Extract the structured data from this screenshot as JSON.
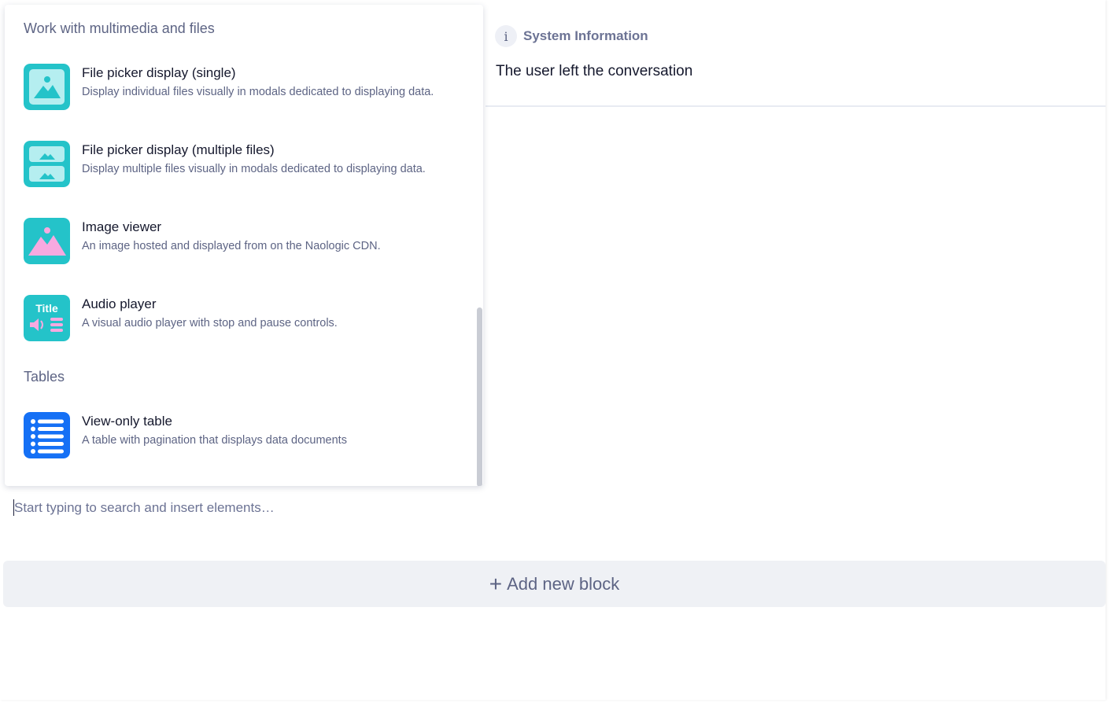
{
  "system_info": {
    "title": "System Information",
    "icon_glyph": "i",
    "message": "The user left the conversation"
  },
  "picker": {
    "sections": [
      {
        "title": "Work with multimedia and files",
        "items": [
          {
            "icon": "file-picker-single-icon",
            "name": "File picker display (single)",
            "description": "Display individual files visually in modals dedicated to displaying data."
          },
          {
            "icon": "file-picker-multiple-icon",
            "name": "File picker display (multiple files)",
            "description": "Display multiple files visually in modals dedicated to displaying data."
          },
          {
            "icon": "image-viewer-icon",
            "name": "Image viewer",
            "description": "An image hosted and displayed from on the Naologic CDN."
          },
          {
            "icon": "audio-player-icon",
            "name": "Audio player",
            "description": "A visual audio player with stop and pause controls.",
            "icon_text": "Title"
          }
        ]
      },
      {
        "title": "Tables",
        "items": [
          {
            "icon": "table-icon",
            "name": "View-only table",
            "description": "A table with pagination that displays data documents"
          }
        ]
      }
    ]
  },
  "search": {
    "placeholder": "Start typing to search and insert elements…",
    "value": ""
  },
  "add_block": {
    "plus": "+",
    "label": "Add new block"
  },
  "colors": {
    "teal": "#24c3c9",
    "teal_light": "#b5eef0",
    "pink": "#f7a9e0",
    "blue": "#1570f5",
    "panel_bg": "#eff1f5",
    "muted_text": "#5d6484"
  }
}
